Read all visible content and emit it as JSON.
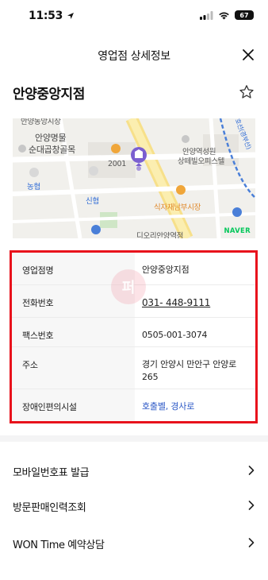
{
  "status_bar": {
    "time": "11:53",
    "battery": "67"
  },
  "header": {
    "title": "영업점 상세정보"
  },
  "branch": {
    "name": "안양중앙지점"
  },
  "map": {
    "labels": [
      {
        "text": "안양동앙시장",
        "cls": ""
      },
      {
        "text": "안양명물",
        "cls": "big"
      },
      {
        "text": "순대곱창골목",
        "cls": "big"
      },
      {
        "text": "2001",
        "cls": ""
      },
      {
        "text": "안양역성원",
        "cls": ""
      },
      {
        "text": "상떼빌오피스텔",
        "cls": ""
      },
      {
        "text": "농협",
        "cls": "blue"
      },
      {
        "text": "신협",
        "cls": "blue"
      },
      {
        "text": "식자재남부시장",
        "cls": "orange"
      },
      {
        "text": "디오리안양역점",
        "cls": ""
      },
      {
        "text": "호선(경부선)",
        "cls": "blue small"
      }
    ],
    "attribution": "NAVER"
  },
  "info": {
    "rows": [
      {
        "label": "영업점명",
        "value": "안양중앙지점"
      },
      {
        "label": "전화번호",
        "value": "031- 448-9111"
      },
      {
        "label": "팩스번호",
        "value": "0505-001-3074"
      },
      {
        "label": "주소",
        "value": "경기 안양시 만안구 안양로 265"
      },
      {
        "label": "장애인편의시설",
        "value": "호출벨, 경사로"
      }
    ]
  },
  "watermark": "퍼",
  "menu": [
    {
      "label": "모바일번호표 발급"
    },
    {
      "label": "방문판매인력조회"
    },
    {
      "label": "WON Time 예약상담"
    }
  ],
  "colors": {
    "highlight_border": "#e8121c",
    "link": "#2b57c6",
    "map_pin": "#7b5fd0"
  },
  "icons": [
    "location-arrow-icon",
    "signal-icon",
    "wifi-icon",
    "battery-icon",
    "close-icon",
    "star-icon",
    "chevron-right-icon",
    "bank-pin-icon"
  ]
}
